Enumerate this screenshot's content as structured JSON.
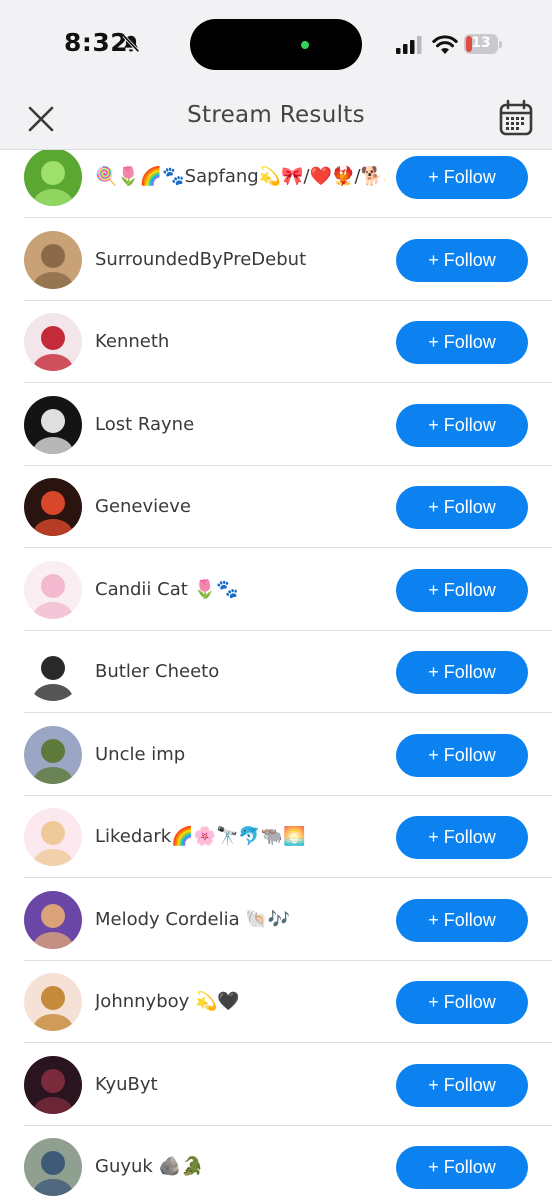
{
  "status_bar": {
    "time": "8:32",
    "battery_level": "13",
    "battery_color": "#e04b46"
  },
  "nav": {
    "title": "Stream Results",
    "close_icon": "close-icon",
    "calendar_icon": "calendar-icon"
  },
  "accent_color": "#0b82f0",
  "follow_label": "+ Follow",
  "users": [
    {
      "name": "🍭🌷🌈🐾Sapfang💫🎀/❤️🐦‍🔥/🐕💫",
      "avatar_bg": "#5aa832",
      "avatar_fg": "#9ee06a"
    },
    {
      "name": "SurroundedByPreDebut",
      "avatar_bg": "#c8a276",
      "avatar_fg": "#8a6a48"
    },
    {
      "name": "Kenneth",
      "avatar_bg": "#f3e6ea",
      "avatar_fg": "#c42b3a"
    },
    {
      "name": "Lost Rayne",
      "avatar_bg": "#141414",
      "avatar_fg": "#e0e0e0"
    },
    {
      "name": "Genevieve",
      "avatar_bg": "#2a1410",
      "avatar_fg": "#d8472a"
    },
    {
      "name": "Candii Cat 🌷🐾",
      "avatar_bg": "#fbeef3",
      "avatar_fg": "#f3b9cf"
    },
    {
      "name": "Butler Cheeto",
      "avatar_bg": "#ffffff",
      "avatar_fg": "#2a2a2a"
    },
    {
      "name": "Uncle imp",
      "avatar_bg": "#9aa6c4",
      "avatar_fg": "#5e7a3a"
    },
    {
      "name": "Likedark🌈🌸🔭🐬🐃🌅",
      "avatar_bg": "#fbe9ef",
      "avatar_fg": "#f0c99a"
    },
    {
      "name": "Melody Cordelia 🐚🎶",
      "avatar_bg": "#6a46a6",
      "avatar_fg": "#d9a27a"
    },
    {
      "name": "Johnnyboy 💫🖤",
      "avatar_bg": "#f6e1d6",
      "avatar_fg": "#c58a3a"
    },
    {
      "name": "KyuByt",
      "avatar_bg": "#2a1420",
      "avatar_fg": "#7a2a3a"
    },
    {
      "name": "Guyuk 🪨🐊",
      "avatar_bg": "#8fa090",
      "avatar_fg": "#3f5a78"
    }
  ]
}
